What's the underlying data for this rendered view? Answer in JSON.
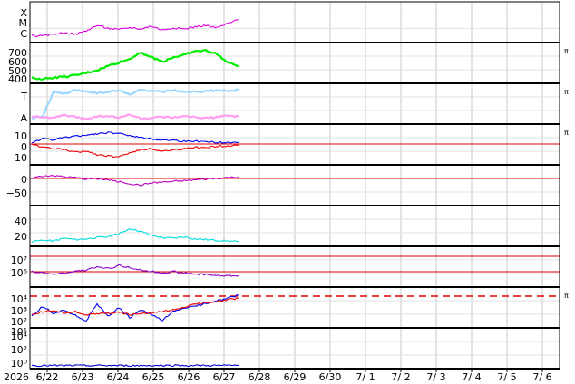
{
  "chart_data": {
    "type": "line",
    "x_axis": {
      "year": "2026",
      "ticks": [
        "6/22",
        "6/23",
        "6/24",
        "6/25",
        "6/26",
        "6/27",
        "6/28",
        "6/29",
        "6/30",
        "7/ 1",
        "7/ 2",
        "7/ 3",
        "7/ 4",
        "7/ 5",
        "7/ 6"
      ],
      "range": [
        "2026-06-21",
        "2026-07-06"
      ],
      "grid": true
    },
    "panels": [
      {
        "id": "xray",
        "ylabels": [
          "X",
          "M",
          "C"
        ],
        "right_mark": "",
        "series": [
          {
            "color": "#e000e0",
            "values": [
              0.12,
              0.1,
              0.16,
              0.2,
              0.15,
              0.25,
              0.4,
              0.32,
              0.28,
              0.34,
              0.3,
              0.38,
              0.27,
              0.33,
              0.3,
              0.36,
              0.4,
              0.33,
              0.45,
              0.56
            ]
          }
        ]
      },
      {
        "id": "solar-wind-speed",
        "ylabels": [
          "700",
          "600",
          "500",
          "400"
        ],
        "right_mark": "π",
        "series": [
          {
            "color": "#00ee00",
            "values": [
              380,
              370,
              385,
              395,
              410,
              440,
              470,
              520,
              560,
              600,
              680,
              620,
              570,
              620,
              650,
              690,
              700,
              660,
              560,
              520
            ]
          }
        ]
      },
      {
        "id": "imf-sector",
        "ylabels": [
          "T",
          "A"
        ],
        "right_mark": "π",
        "series": [
          {
            "color": "#9ad8ff",
            "name": "T",
            "values": [
              0.1,
              0.15,
              0.85,
              0.8,
              0.9,
              0.88,
              0.82,
              0.86,
              0.9,
              0.78,
              0.92,
              0.88,
              0.85,
              0.9,
              0.84,
              0.86,
              0.88,
              0.9,
              0.87,
              0.92
            ]
          },
          {
            "color": "#ff9ef0",
            "name": "A",
            "values": [
              0.15,
              0.12,
              0.1,
              0.18,
              0.12,
              0.08,
              0.14,
              0.16,
              0.1,
              0.2,
              0.08,
              0.1,
              0.12,
              0.1,
              0.14,
              0.12,
              0.1,
              0.12,
              0.16,
              0.14
            ]
          }
        ]
      },
      {
        "id": "bz",
        "ylabels": [
          "10",
          "0",
          "−10"
        ],
        "right_mark": "π",
        "series": [
          {
            "color": "#0000ee",
            "values": [
              2,
              5,
              4,
              6,
              7,
              8,
              9,
              10,
              9,
              8,
              6,
              5,
              4,
              4,
              3,
              3,
              3,
              2,
              2,
              2
            ]
          },
          {
            "color": "#ee0000",
            "values": [
              1,
              -2,
              -3,
              -4,
              -6,
              -5,
              -8,
              -9,
              -10,
              -6,
              -4,
              -3,
              -5,
              -4,
              -3,
              -2,
              -2,
              -1,
              -1,
              0
            ]
          }
        ]
      },
      {
        "id": "dst",
        "ylabels": [
          "0",
          "−50"
        ],
        "right_mark": "",
        "series": [
          {
            "color": "#bb00bb",
            "values": [
              -5,
              0,
              2,
              -2,
              -4,
              -8,
              -6,
              -10,
              -14,
              -20,
              -24,
              -18,
              -16,
              -14,
              -12,
              -10,
              -8,
              -6,
              -4,
              -2
            ]
          }
        ]
      },
      {
        "id": "density",
        "ylabels": [
          "40",
          "20"
        ],
        "right_mark": "",
        "series": [
          {
            "color": "#00dddd",
            "values": [
              3,
              5,
              4,
              8,
              6,
              7,
              9,
              10,
              14,
              22,
              18,
              12,
              9,
              8,
              10,
              7,
              6,
              5,
              4,
              3
            ]
          }
        ]
      },
      {
        "id": "electron-flux",
        "ylabels": [
          "10⁷",
          "10⁶"
        ],
        "right_mark": "",
        "series": [
          {
            "color": "#8800cc",
            "values": [
              5.9,
              5.8,
              5.7,
              5.8,
              5.9,
              6.0,
              6.2,
              6.1,
              6.3,
              6.2,
              6.0,
              5.9,
              5.8,
              5.9,
              5.8,
              5.7,
              5.7,
              5.6,
              5.6,
              5.6
            ]
          }
        ]
      },
      {
        "id": "proton-flux",
        "ylabels": [
          "10⁴",
          "10³",
          "10²",
          "10¹"
        ],
        "right_mark": "π",
        "series": [
          {
            "color": "#0000ee",
            "values": [
              1.2,
              2.5,
              1.6,
              2.0,
              1.3,
              0.6,
              2.8,
              1.2,
              2.3,
              1.0,
              2.0,
              1.4,
              0.6,
              1.8,
              2.3,
              2.5,
              2.9,
              3.3,
              3.6,
              4.0
            ]
          },
          {
            "color": "#ee0000",
            "values": [
              1.4,
              1.8,
              2.0,
              1.6,
              1.8,
              1.4,
              1.5,
              1.6,
              1.7,
              1.4,
              1.5,
              1.6,
              1.8,
              2.0,
              2.4,
              2.8,
              3.0,
              3.2,
              3.4,
              3.6
            ]
          }
        ]
      },
      {
        "id": "neutron",
        "ylabels": [
          "10⁴",
          "10²",
          "10⁰"
        ],
        "right_mark": "",
        "series": [
          {
            "color": "#0000cc",
            "values": [
              0.05,
              0.05,
              0.05,
              0.06,
              0.05,
              0.05,
              0.05,
              0.06,
              0.05,
              0.05,
              0.05,
              0.05,
              0.06,
              0.05,
              0.05,
              0.05,
              0.06,
              0.06,
              0.07,
              0.08
            ]
          }
        ]
      }
    ]
  }
}
